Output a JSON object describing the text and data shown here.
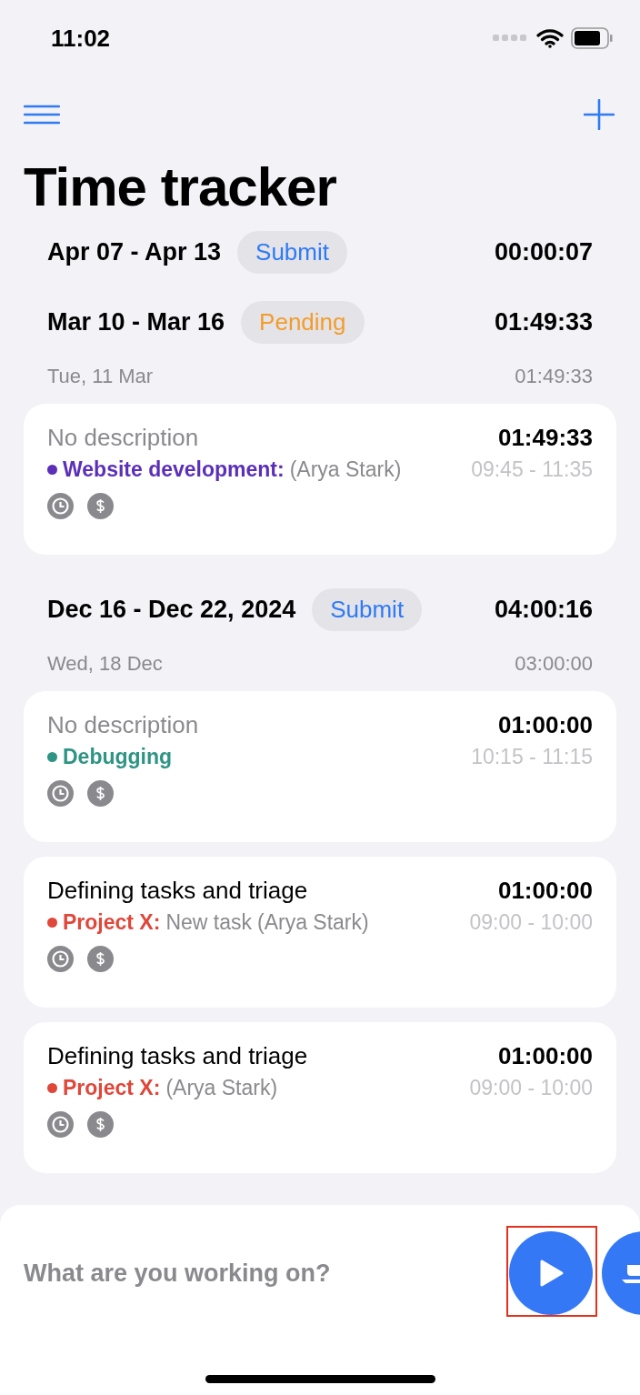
{
  "status_bar": {
    "time": "11:02"
  },
  "title": "Time tracker",
  "weeks": [
    {
      "range": "Apr 07 - Apr 13",
      "badge": {
        "label": "Submit",
        "kind": "submit"
      },
      "total": "00:00:07"
    },
    {
      "range": "Mar 10 - Mar 16",
      "badge": {
        "label": "Pending",
        "kind": "pending"
      },
      "total": "01:49:33",
      "days": [
        {
          "date": "Tue, 11 Mar",
          "total": "01:49:33",
          "entries": [
            {
              "description": "No description",
              "muted": true,
              "project": "Website development:",
              "color": "#5b2fb8",
              "person": "(Arya Stark)",
              "span": "09:45 - 11:35",
              "duration": "01:49:33"
            }
          ]
        }
      ]
    },
    {
      "range": "Dec 16 - Dec 22, 2024",
      "badge": {
        "label": "Submit",
        "kind": "submit"
      },
      "total": "04:00:16",
      "days": [
        {
          "date": "Wed, 18 Dec",
          "total": "03:00:00",
          "entries": [
            {
              "description": "No description",
              "muted": true,
              "project": "Debugging",
              "color": "#2e9483",
              "span": "10:15 - 11:15",
              "duration": "01:00:00"
            },
            {
              "description": "Defining tasks and triage",
              "muted": false,
              "project": "Project X:",
              "color": "#e0463a",
              "task": "New task",
              "person": "(Arya Stark)",
              "span": "09:00 - 10:00",
              "duration": "01:00:00"
            },
            {
              "description": "Defining tasks and triage",
              "muted": false,
              "project": "Project X:",
              "color": "#e0463a",
              "person": "(Arya Stark)",
              "span": "09:00 - 10:00",
              "duration": "01:00:00"
            }
          ]
        }
      ]
    }
  ],
  "composer": {
    "placeholder": "What are you working on?",
    "highlighted": true
  }
}
